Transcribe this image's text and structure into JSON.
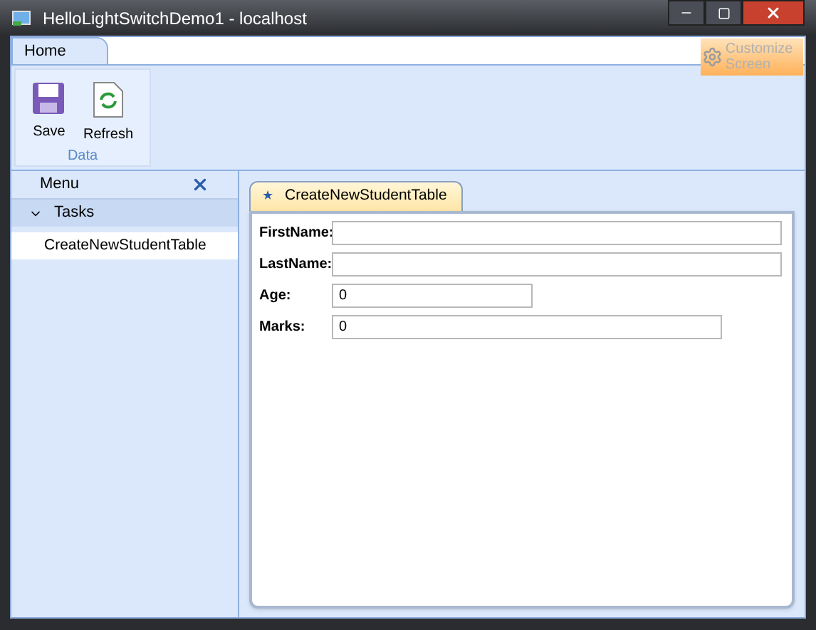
{
  "window": {
    "title": "HelloLightSwitchDemo1 - localhost"
  },
  "ribbon": {
    "tabs": [
      {
        "label": "Home",
        "selected": true
      }
    ],
    "customize": "Customize Screen",
    "groups": [
      {
        "label": "Data",
        "buttons": [
          {
            "kind": "save",
            "label": "Save"
          },
          {
            "kind": "refresh",
            "label": "Refresh"
          }
        ]
      }
    ]
  },
  "menu": {
    "title": "Menu",
    "sections": [
      {
        "label": "Tasks",
        "expanded": true,
        "children": [
          {
            "label": "CreateNewStudentTable",
            "selected": true
          }
        ]
      }
    ]
  },
  "document": {
    "tab": {
      "mark": "★",
      "label": "CreateNewStudentTable"
    },
    "fields": [
      {
        "label": "FirstName:"
      },
      {
        "label": "LastName:"
      },
      {
        "label": "Age:",
        "value": "0"
      },
      {
        "label": "Marks:",
        "value": "0"
      }
    ]
  }
}
